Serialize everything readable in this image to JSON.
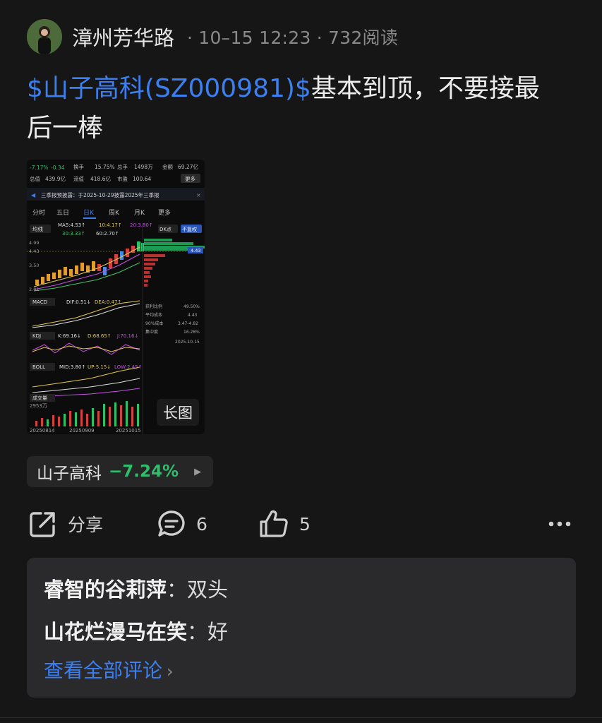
{
  "header": {
    "username": "漳州芳华路",
    "separator": "·",
    "timestamp": "10–15 12:23",
    "reads": "732阅读"
  },
  "post": {
    "stock_tag": "$山子高科(SZ000981)$",
    "text_line1": "基本到顶，不要接最",
    "text_line2": "后一棒"
  },
  "thumbnail": {
    "badge": "长图",
    "top_row": [
      "-7.17%",
      "-0.34",
      "换手",
      "15.75%",
      "总手",
      "1498万",
      "金额",
      "69.27亿"
    ],
    "second_row": [
      "总值",
      "439.9亿",
      "流值",
      "418.6亿",
      "市盈",
      "100.64",
      "更多"
    ],
    "notice": "三季报预披露：于2025-10-29披露2025年三季报",
    "tabs": [
      "分时",
      "五日",
      "日K",
      "周K",
      "月K",
      "更多"
    ],
    "ma_labels": [
      "MA5:4.53↑",
      "10:4.17↑",
      "20:3.80↑",
      "30:3.33↑",
      "60:2.70↑"
    ],
    "price_labels": [
      "4.99",
      "4.43",
      "3.50",
      "2.01"
    ],
    "indicators": [
      "MACD",
      "KDJ",
      "BOLL",
      "成交量"
    ],
    "macd_vals": [
      "DIF:0.51↓",
      "DEA:0.47↑"
    ],
    "kdj_vals": [
      "K:69.16↓",
      "D:68.65↑",
      "J:70.16↓"
    ],
    "boll_vals": [
      "MID:3.80↑",
      "UP:5.15↓",
      "LOW:2.45↑"
    ],
    "stats": [
      [
        "获利比例",
        "49.50%"
      ],
      [
        "平均成本",
        "4.43"
      ],
      [
        "90%成本",
        "3.47-4.82"
      ],
      [
        "集中度",
        "16.28%"
      ]
    ],
    "stats_date": "2025-10-15",
    "vol_label": "2953万",
    "dates": [
      "20250814",
      "20250909",
      "20251015"
    ]
  },
  "stock_chip": {
    "name": "山子高科",
    "change": "−7.24%",
    "up_color": "#2fbf6c"
  },
  "actions": {
    "share_label": "分享",
    "comment_count": "6",
    "like_count": "5"
  },
  "comments": {
    "items": [
      {
        "author": "睿智的谷莉萍",
        "sep": "：",
        "text": "双头"
      },
      {
        "author": "山花烂漫马在笑",
        "sep": "：",
        "text": "好"
      }
    ],
    "view_all": "查看全部评论",
    "chevron": "›"
  },
  "colors": {
    "accent_blue": "#3c7ff0",
    "background": "#161616",
    "card": "#2a2a2c"
  }
}
